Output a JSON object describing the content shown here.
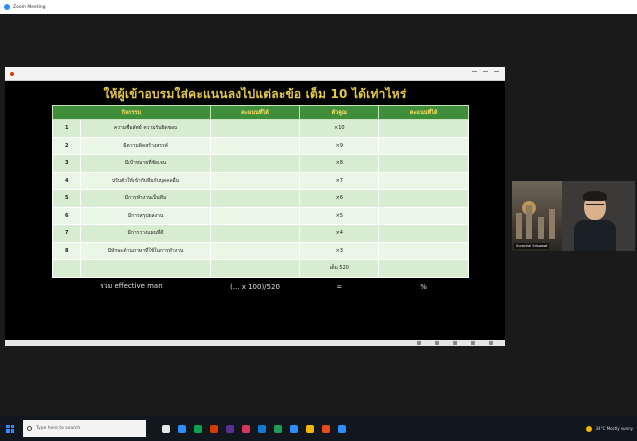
{
  "window": {
    "title": "Zoom Meeting"
  },
  "share": {
    "doc_title": ""
  },
  "slide": {
    "title": "ให้ผู้เข้าอบรมใส่คะแนนลงไปแต่ละข้อ เต็ม 10 ได้เท่าไหร่",
    "headers": [
      "กิจกรรม",
      "คะแนนที่ได้",
      "ตัวคูณ",
      "คะแนนที่ได้"
    ],
    "rows": [
      {
        "num": "1",
        "activity": "ความซื่อสัตย์ ความรับผิดชอบ",
        "multiplier": "×10"
      },
      {
        "num": "2",
        "activity": "มีความคิดสร้างสรรค์",
        "multiplier": "×9"
      },
      {
        "num": "3",
        "activity": "มีเป้าหมายที่ชัดเจน",
        "multiplier": "×8"
      },
      {
        "num": "4",
        "activity": "ปรับตัวให้เข้ากับทีมกับบุคคลอื่น",
        "multiplier": "×7"
      },
      {
        "num": "5",
        "activity": "มีการทำงานเป็นทีม",
        "multiplier": "×6"
      },
      {
        "num": "6",
        "activity": "มีการสรุปผลงาน",
        "multiplier": "×5"
      },
      {
        "num": "7",
        "activity": "มีการวางแผนที่ดี",
        "multiplier": "×4"
      },
      {
        "num": "8",
        "activity": "มีทักษะด้านภาษาที่ใช้ในการทำงาน",
        "multiplier": "×3"
      }
    ],
    "total_label": "เต็ม 520",
    "summary": {
      "label": "รวม effective man",
      "formula": "(... x 100)/520",
      "equals": "=",
      "percent": "%"
    }
  },
  "video": {
    "participant_name": "Surachai Srisawat"
  },
  "taskbar": {
    "search_placeholder": "Type here to search",
    "weather": "34°C Mostly sunny",
    "icon_colors": [
      "#e6e6e6",
      "#2d8cff",
      "#0aa34f",
      "#d83b01",
      "#5b2e91",
      "#d8365c",
      "#0f7bd6",
      "#1f9d55",
      "#2d8cff",
      "#f5b700",
      "#e64a19",
      "#2d8cff"
    ]
  },
  "colors": {
    "title_gold": "#e6c84a",
    "header_green": "#3f8f3a",
    "header_text": "#ffe066",
    "row_light": "#eaf6e6",
    "row_mid": "#d8ecd1"
  }
}
